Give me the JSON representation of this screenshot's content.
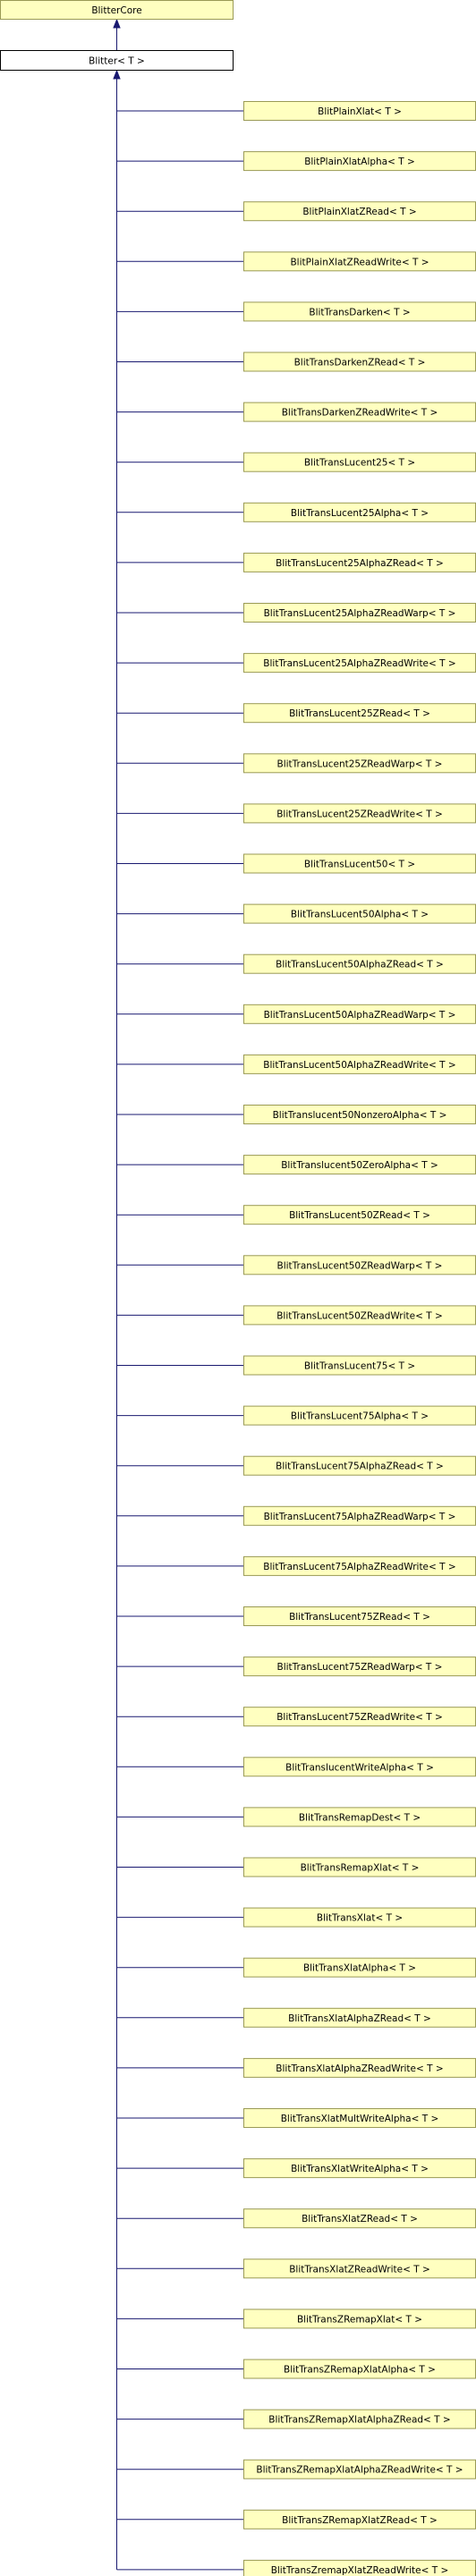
{
  "colors": {
    "node_fill": "#ffffc0",
    "node_border": "#9a9a55",
    "selected_fill": "#ffffff",
    "selected_border": "#000000",
    "edge": "#191970"
  },
  "core": {
    "label": "BlitterCore"
  },
  "blitter": {
    "label": "Blitter< T >"
  },
  "children": [
    "BlitPlainXlat< T >",
    "BlitPlainXlatAlpha< T >",
    "BlitPlainXlatZRead< T >",
    "BlitPlainXlatZReadWrite< T >",
    "BlitTransDarken< T >",
    "BlitTransDarkenZRead< T >",
    "BlitTransDarkenZReadWrite< T >",
    "BlitTransLucent25< T >",
    "BlitTransLucent25Alpha< T >",
    "BlitTransLucent25AlphaZRead< T >",
    "BlitTransLucent25AlphaZReadWarp< T >",
    "BlitTransLucent25AlphaZReadWrite< T >",
    "BlitTransLucent25ZRead< T >",
    "BlitTransLucent25ZReadWarp< T >",
    "BlitTransLucent25ZReadWrite< T >",
    "BlitTransLucent50< T >",
    "BlitTransLucent50Alpha< T >",
    "BlitTransLucent50AlphaZRead< T >",
    "BlitTransLucent50AlphaZReadWarp< T >",
    "BlitTransLucent50AlphaZReadWrite< T >",
    "BlitTranslucent50NonzeroAlpha< T >",
    "BlitTranslucent50ZeroAlpha< T >",
    "BlitTransLucent50ZRead< T >",
    "BlitTransLucent50ZReadWarp< T >",
    "BlitTransLucent50ZReadWrite< T >",
    "BlitTransLucent75< T >",
    "BlitTransLucent75Alpha< T >",
    "BlitTransLucent75AlphaZRead< T >",
    "BlitTransLucent75AlphaZReadWarp< T >",
    "BlitTransLucent75AlphaZReadWrite< T >",
    "BlitTransLucent75ZRead< T >",
    "BlitTransLucent75ZReadWarp< T >",
    "BlitTransLucent75ZReadWrite< T >",
    "BlitTranslucentWriteAlpha< T >",
    "BlitTransRemapDest< T >",
    "BlitTransRemapXlat< T >",
    "BlitTransXlat< T >",
    "BlitTransXlatAlpha< T >",
    "BlitTransXlatAlphaZRead< T >",
    "BlitTransXlatAlphaZReadWrite< T >",
    "BlitTransXlatMultWriteAlpha< T >",
    "BlitTransXlatWriteAlpha< T >",
    "BlitTransXlatZRead< T >",
    "BlitTransXlatZReadWrite< T >",
    "BlitTransZRemapXlat< T >",
    "BlitTransZRemapXlatAlpha< T >",
    "BlitTransZRemapXlatAlphaZRead< T >",
    "BlitTransZRemapXlatAlphaZReadWrite< T >",
    "BlitTransZRemapXlatZRead< T >",
    "BlitTransZremapXlatZReadWrite< T >"
  ]
}
